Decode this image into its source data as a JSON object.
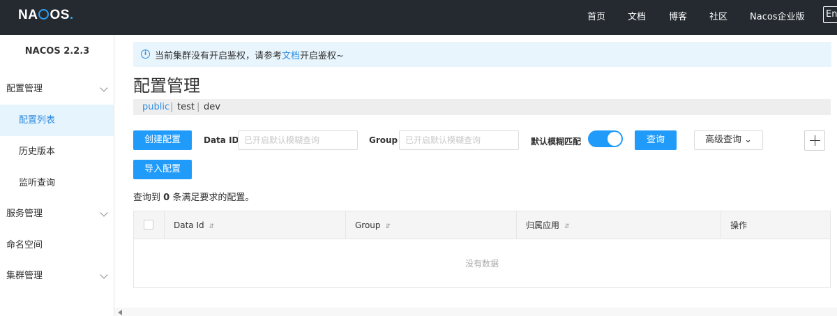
{
  "header": {
    "logo_pre": "NA",
    "logo_post": "OS",
    "logo_dot": ".",
    "nav": [
      "首页",
      "文档",
      "博客",
      "社区",
      "Nacos企业版"
    ],
    "lang": "En"
  },
  "sidebar": {
    "version": "NACOS 2.2.3",
    "items": [
      {
        "label": "配置管理",
        "level": 1,
        "expandable": true
      },
      {
        "label": "配置列表",
        "level": 2,
        "active": true
      },
      {
        "label": "历史版本",
        "level": 2
      },
      {
        "label": "监听查询",
        "level": 2
      },
      {
        "label": "服务管理",
        "level": 1,
        "expandable": true
      },
      {
        "label": "命名空间",
        "level": 1
      },
      {
        "label": "集群管理",
        "level": 1,
        "expandable": true
      }
    ]
  },
  "notice": {
    "icon": "info-icon",
    "text_before": "当前集群没有开启鉴权，请参考",
    "link": "文档",
    "text_after": "开启鉴权~"
  },
  "page": {
    "title": "配置管理",
    "namespaces": [
      "public",
      "test",
      "dev"
    ],
    "selected_namespace": "public",
    "separator": "|"
  },
  "toolbar": {
    "create_label": "创建配置",
    "import_label": "导入配置",
    "data_id_label": "Data ID",
    "data_id_placeholder": "已开启默认模糊查询",
    "group_label": "Group",
    "group_placeholder": "已开启默认模糊查询",
    "fuzzy_label": "默认模糊匹配",
    "fuzzy_enabled": true,
    "query_label": "查询",
    "advanced_label": "高级查询 ⌄"
  },
  "result": {
    "prefix": "查询到 ",
    "count": "0",
    "suffix": " 条满足要求的配置。"
  },
  "table": {
    "columns": [
      "Data Id",
      "Group",
      "归属应用",
      "操作"
    ],
    "sort_icon": "⇵",
    "empty_text": "没有数据"
  },
  "colors": {
    "primary": "#209bfa",
    "topbar": "#242a30",
    "link": "#2e8de4"
  }
}
